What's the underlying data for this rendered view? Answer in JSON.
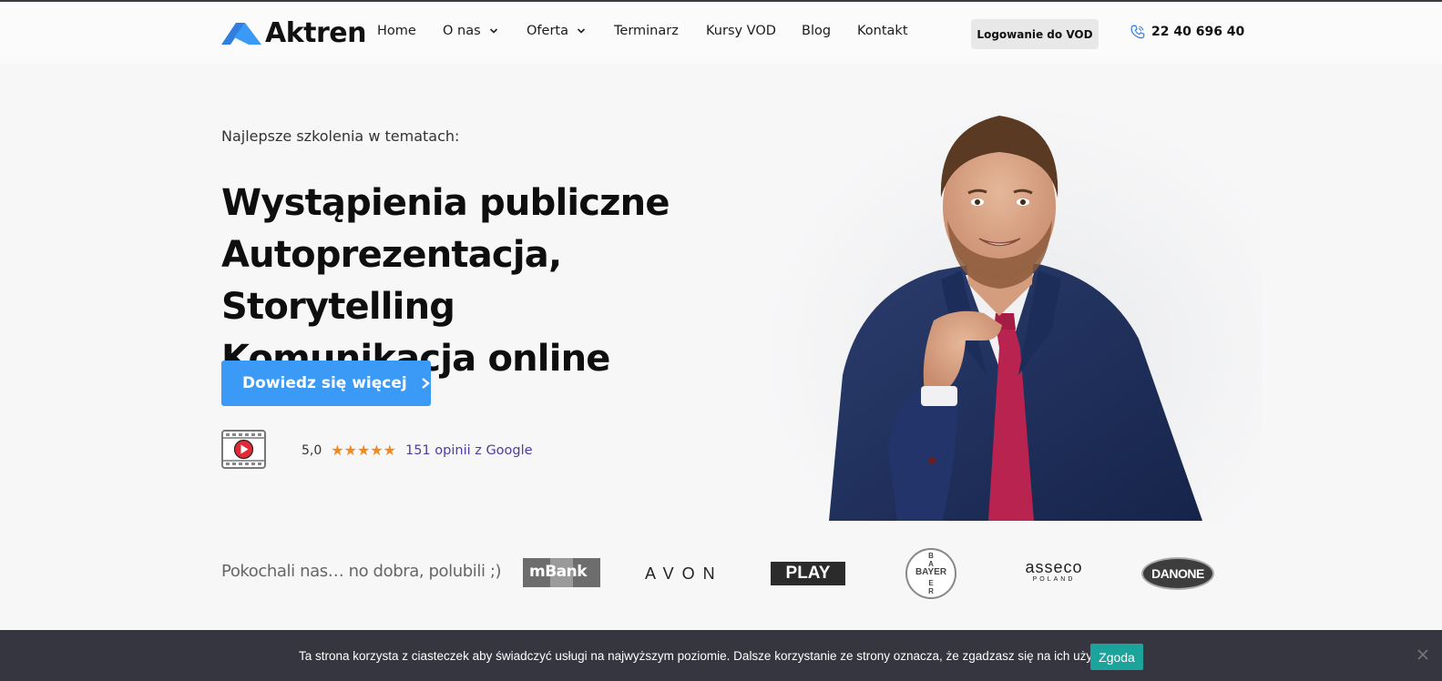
{
  "header": {
    "logo_text": "Aktren",
    "nav": [
      {
        "label": "Home",
        "dropdown": false
      },
      {
        "label": "O nas",
        "dropdown": true
      },
      {
        "label": "Oferta",
        "dropdown": true
      },
      {
        "label": "Terminarz",
        "dropdown": false
      },
      {
        "label": "Kursy VOD",
        "dropdown": false
      },
      {
        "label": "Blog",
        "dropdown": false
      },
      {
        "label": "Kontakt",
        "dropdown": false
      }
    ],
    "login_label": "Logowanie do VOD",
    "phone": "22 40 696 40"
  },
  "hero": {
    "subtitle": "Najlepsze szkolenia w tematach:",
    "headline_lines": [
      "Wystąpienia publiczne",
      "Autoprezentacja, Storytelling",
      "Komunikacja online"
    ],
    "cta_label": "Dowiedz się więcej",
    "rating_value": "5,0",
    "stars": "★★★★★",
    "reviews_label": "151 opinii z Google"
  },
  "clients": {
    "label": "Pokochali nas… no dobra, polubili ;)",
    "logos": [
      "mBank",
      "AVON",
      "PLAY",
      "BAYER",
      "asseco",
      "POLAND",
      "DANONE"
    ]
  },
  "cookie": {
    "text": "Ta strona korzysta z ciasteczek aby świadczyć usługi na najwyższym poziomie. Dalsze korzystanie ze strony oznacza, że zgadzasz się na ich użycie.",
    "accept_label": "Zgoda"
  },
  "colors": {
    "accent": "#3c9af7",
    "star": "#f08a1f",
    "reviews_link": "#4a3ea6",
    "cookie_bg": "#353640",
    "cookie_btn": "#1ba39c"
  }
}
